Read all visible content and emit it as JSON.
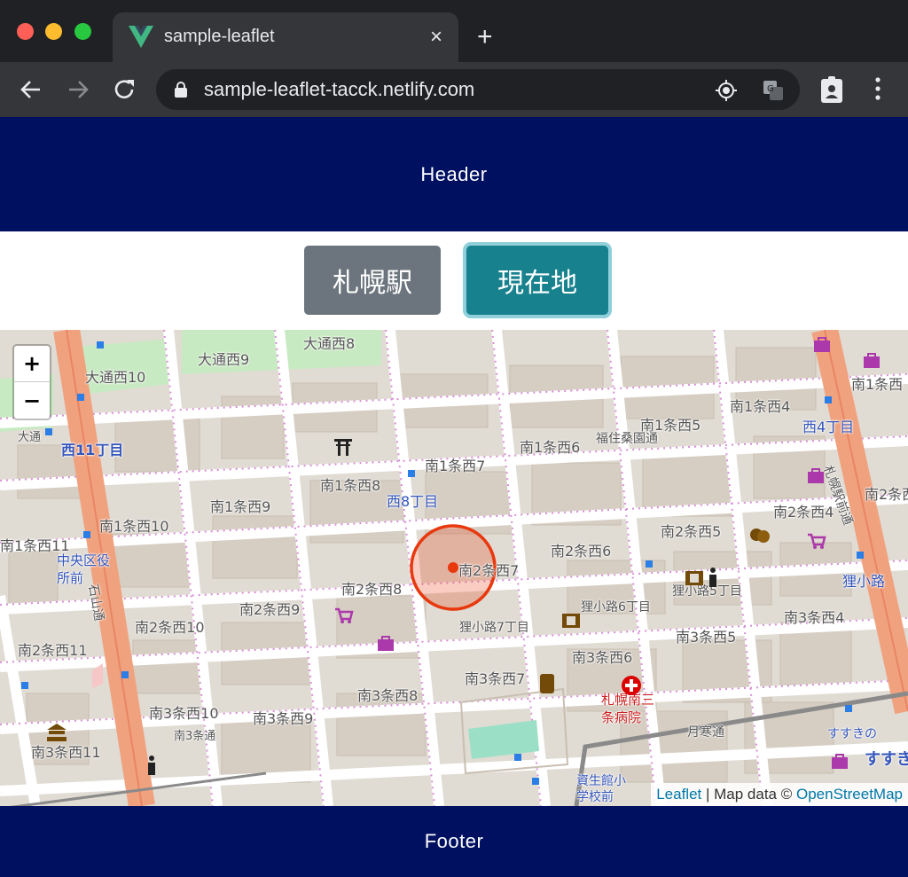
{
  "browser": {
    "tab_title": "sample-leaflet",
    "new_tab_label": "+",
    "close_tab_label": "×",
    "url": "sample-leaflet-tacck.netlify.com"
  },
  "header": {
    "text": "Header"
  },
  "buttons": {
    "sapporo_station": "札幌駅",
    "current_location": "現在地"
  },
  "map": {
    "zoom_in": "+",
    "zoom_out": "−",
    "attribution": {
      "leaflet": "Leaflet",
      "separator": " | Map data © ",
      "osm": "OpenStreetMap"
    },
    "labels": [
      "大通西8",
      "大通西9",
      "大通西10",
      "西11丁目",
      "南1条西4",
      "南1条西5",
      "南1条西6",
      "福住桑園通",
      "南1条西7",
      "南1条西8",
      "西8丁目",
      "南1条西9",
      "南1条西10",
      "南1条西11",
      "中央区役所前",
      "南2条西6",
      "南2条西7",
      "南2条西8",
      "南2条西9",
      "南2条西10",
      "南2条西11",
      "南2条西4",
      "南2条西5",
      "南2条西",
      "狸小路6丁目",
      "狸小路5丁目",
      "狸小路7丁目",
      "南3条西4",
      "南3条西5",
      "南3条西6",
      "南3条西7",
      "南3条西8",
      "南3条西9",
      "南3条西10",
      "南3条西11",
      "札幌南三条病院",
      "月寒通",
      "西4丁目",
      "札幌駅前通",
      "狸小路",
      "大通",
      "南1条西",
      "資生館小学校前",
      "すすきの",
      "すすき",
      "石山通",
      "南3条通"
    ],
    "accent_color": "#e8380d"
  },
  "footer": {
    "text": "Footer"
  }
}
